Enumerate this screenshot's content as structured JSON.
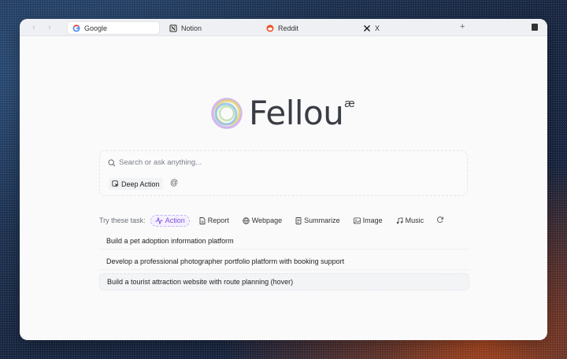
{
  "browser": {
    "tabs": [
      {
        "label": "Google",
        "icon": "google-icon",
        "active": true
      },
      {
        "label": "Notion",
        "icon": "notion-icon",
        "active": false
      },
      {
        "label": "Reddit",
        "icon": "reddit-icon",
        "active": false
      },
      {
        "label": "X",
        "icon": "x-icon",
        "active": false
      }
    ],
    "new_tab_label": "+"
  },
  "logo": {
    "text": "Fellou",
    "sup": "æ"
  },
  "search": {
    "placeholder": "Search or ask anything...",
    "deep_action_label": "Deep Action",
    "mention_label": "@"
  },
  "tasks": {
    "try_label": "Try these task:",
    "chips": [
      {
        "label": "Action",
        "icon": "action-icon",
        "active": true
      },
      {
        "label": "Report",
        "icon": "report-icon",
        "active": false
      },
      {
        "label": "Webpage",
        "icon": "globe-icon",
        "active": false
      },
      {
        "label": "Summarize",
        "icon": "document-icon",
        "active": false
      },
      {
        "label": "Image",
        "icon": "image-icon",
        "active": false
      },
      {
        "label": "Music",
        "icon": "music-icon",
        "active": false
      }
    ]
  },
  "suggestions": [
    "Build a pet adoption information platform",
    "Develop a professional photographer portfolio platform with booking support",
    "Build a tourist attraction website with route planning (hover)"
  ],
  "colors": {
    "accent": "#7a4fd6",
    "reddit": "#e9542a"
  }
}
